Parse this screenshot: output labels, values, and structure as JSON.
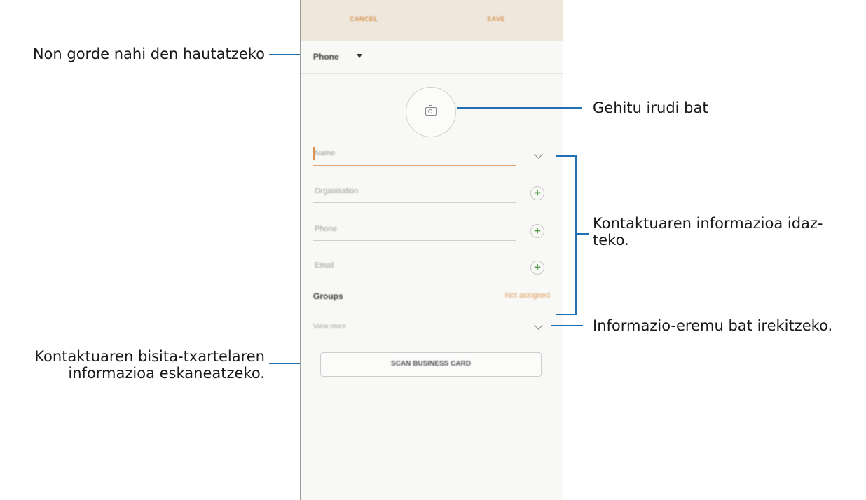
{
  "annotations": {
    "storage": "Non gorde nahi den hautatzeko",
    "add_image": "Gehitu irudi bat",
    "contact_info_line1": "Kontaktuaren informazioa idaz-",
    "contact_info_line2": "teko.",
    "open_field": "Informazio-eremu bat irekitzeko.",
    "scan_line1": "Kontaktuaren bisita-txartelaren",
    "scan_line2": "informazioa eskaneatzeko."
  },
  "phone": {
    "topbar": {
      "cancel": "CANCEL",
      "save": "SAVE"
    },
    "storage_location": "Phone",
    "fields": [
      {
        "placeholder": "Name",
        "action": "expand"
      },
      {
        "placeholder": "Organisation",
        "action": "add"
      },
      {
        "placeholder": "Phone",
        "action": "add"
      },
      {
        "placeholder": "Email",
        "action": "add"
      }
    ],
    "groups": {
      "label": "Groups",
      "value": "Not assigned"
    },
    "view_more": "View more",
    "scan_button": "SCAN BUSINESS CARD"
  },
  "colors": {
    "accent": "#d8914f",
    "callout_line": "#1f6fb2",
    "plus_green": "#5aa04a"
  },
  "icons": [
    "camera-icon",
    "chevron-down-icon",
    "plus-icon",
    "dropdown-caret-icon"
  ]
}
